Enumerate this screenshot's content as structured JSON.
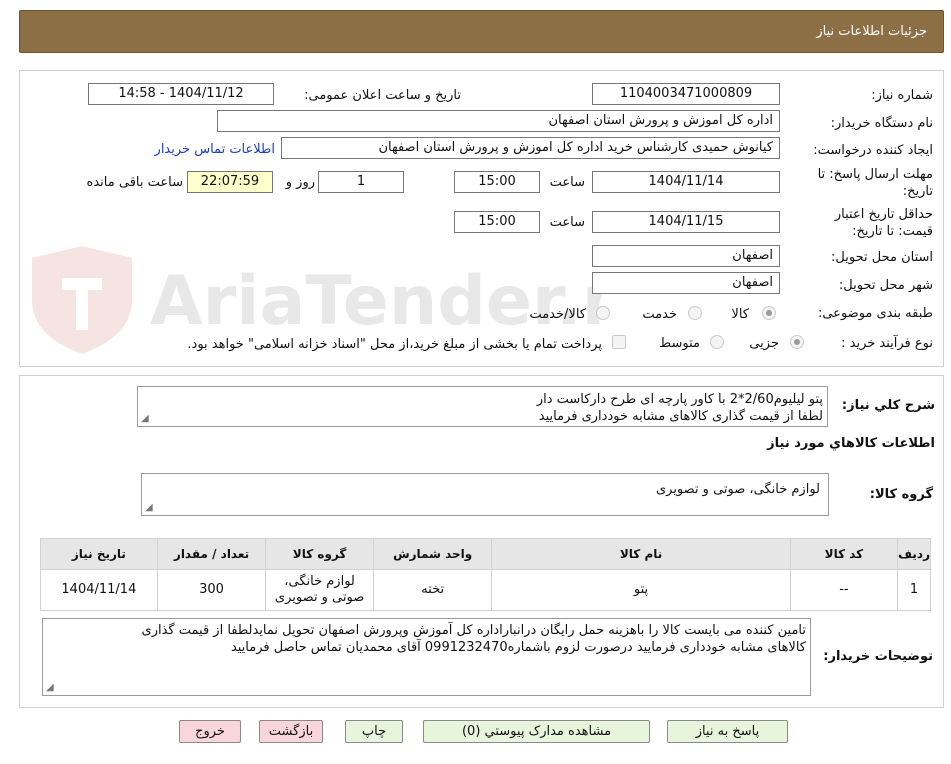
{
  "header": {
    "title": "جزئیات اطلاعات نیاز"
  },
  "watermark": {
    "text": "AriaTender.neT"
  },
  "info": {
    "need_number_label": "شماره نیاز:",
    "need_number": "1104003471000809",
    "announce_label": "تاریخ و ساعت اعلان عمومی:",
    "announce_value": "1404/11/12 - 14:58",
    "buyer_label": "نام دستگاه خریدار:",
    "buyer_value": "اداره کل اموزش و پرورش استان اصفهان",
    "creator_label": "ایجاد کننده درخواست:",
    "creator_value": "کیانوش حمیدی کارشناس خرید اداره کل اموزش و پرورش استان اصفهان",
    "contact_link": "اطلاعات تماس خریدار",
    "deadline_label_1": "مهلت ارسال پاسخ: تا",
    "deadline_label_2": "تاریخ:",
    "deadline_date": "1404/11/14",
    "time_label": "ساعت",
    "deadline_time": "15:00",
    "days_value": "1",
    "days_label": "روز و",
    "remaining_time": "22:07:59",
    "remaining_label": "ساعت باقی مانده",
    "validity_label_1": "حداقل تاریخ اعتبار",
    "validity_label_2": "قیمت: تا تاریخ:",
    "validity_date": "1404/11/15",
    "validity_time": "15:00",
    "province_label": "استان محل تحویل:",
    "province_value": "اصفهان",
    "city_label": "شهر محل تحویل:",
    "city_value": "اصفهان",
    "category_label": "طبقه بندی موضوعی:",
    "category_options": [
      "کالا",
      "خدمت",
      "کالا/خدمت"
    ],
    "category_selected": "کالا",
    "process_label": "نوع فرآیند خرید :",
    "process_options": [
      "جزیی",
      "متوسط"
    ],
    "process_selected": "جزیی",
    "treasury_note": "پرداخت تمام یا بخشی از مبلغ خرید،از محل \"اسناد خزانه اسلامی\" خواهد بود."
  },
  "summary": {
    "label": "شرح كلي نياز:",
    "line1": "پتو لیلیوم2/60*2 با کاور پارچه ای طرح دارکاست دار",
    "line2": "لطفا از قیمت گذاری کالاهای مشابه خودداری فرمایید"
  },
  "goods_section": {
    "title": "اطلاعات كالاهاي مورد نياز",
    "group_label": "گروه کالا:",
    "group_value": "لوازم خانگی، صوتی و تصویری"
  },
  "table": {
    "headers": [
      "ردیف",
      "کد کالا",
      "نام کالا",
      "واحد شمارش",
      "گروه کالا",
      "تعداد / مقدار",
      "تاریخ نیاز"
    ],
    "rows": [
      {
        "index": "1",
        "code": "--",
        "name": "پتو",
        "unit": "تخته",
        "group_line1": "لوازم خانگی،",
        "group_line2": "صوتی و تصویری",
        "quantity": "300",
        "date": "1404/11/14"
      }
    ]
  },
  "buyer_notes": {
    "label": "توضیحات خریدار:",
    "line1": "تامین کننده می بایست کالا را باهزینه حمل رایگان درانباراداره کل آموزش وپرورش  اصفهان تحویل نمایدلطفا از قیمت گذاری",
    "line2": "کالاهای مشابه خودداری فرمایید درصورت لزوم باشماره0991232470 آقای محمدیان تماس حاصل فرمایید"
  },
  "buttons": {
    "reply": "پاسخ به نیاز",
    "attachments": "مشاهده مدارک پیوستي (0)",
    "print": "چاپ",
    "back": "بازگشت",
    "exit": "خروج"
  },
  "colors": {
    "header_bg": "#8c6f44",
    "link": "#1a3fc4",
    "green_button": "#e7f5dd",
    "pink_button": "#f8d6dc",
    "remaining_bg": "#ffffcc"
  }
}
